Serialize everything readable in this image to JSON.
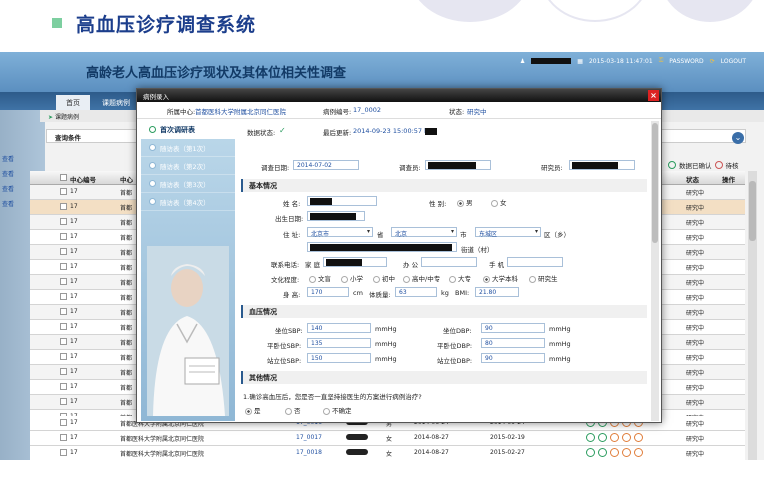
{
  "slide": {
    "title": "高血压诊疗调查系统"
  },
  "app": {
    "title": "高龄老人高血压诊疗现状及其体位相关性调查",
    "datetime": "2015-03-18 11:47:01",
    "password_label": "PASSWORD",
    "logout_label": "LOGOUT",
    "nav": {
      "home": "首页",
      "active_tab": "课题病例"
    },
    "breadcrumb": "课题病例",
    "query_label": "查询条件",
    "left_links": [
      "查看",
      "查看",
      "查看",
      "查看"
    ],
    "legend": {
      "confirm": "数据已确认",
      "pending": "待核"
    },
    "grid_head": {
      "center_id": "中心编号",
      "center": "中心",
      "status": "状态",
      "action": "操作"
    },
    "grid_rows": [
      {
        "center_id": "17",
        "center": "首都",
        "status": "研究中"
      },
      {
        "center_id": "17",
        "center": "首都",
        "status": "研究中",
        "selected": true
      },
      {
        "center_id": "17",
        "center": "首都",
        "status": "研究中"
      },
      {
        "center_id": "17",
        "center": "首都",
        "status": "研究中"
      },
      {
        "center_id": "17",
        "center": "首都",
        "status": "研究中"
      },
      {
        "center_id": "17",
        "center": "首都",
        "status": "研究中"
      },
      {
        "center_id": "17",
        "center": "首都",
        "status": "研究中"
      },
      {
        "center_id": "17",
        "center": "首都",
        "status": "研究中"
      },
      {
        "center_id": "17",
        "center": "首都",
        "status": "研究中"
      },
      {
        "center_id": "17",
        "center": "首都",
        "status": "研究中"
      },
      {
        "center_id": "17",
        "center": "首都",
        "status": "研究中"
      },
      {
        "center_id": "17",
        "center": "首都",
        "status": "研究中"
      },
      {
        "center_id": "17",
        "center": "首都",
        "status": "研究中"
      },
      {
        "center_id": "17",
        "center": "首都",
        "status": "研究中"
      },
      {
        "center_id": "17",
        "center": "首都",
        "status": "研究中"
      },
      {
        "center_id": "17",
        "center": "首都",
        "status": "研究中"
      },
      {
        "center_id": "17",
        "center": "首都",
        "status": "研究中"
      },
      {
        "center_id": "17",
        "center": "首都",
        "status": "研究中"
      }
    ],
    "bottom_rows": [
      {
        "center_id": "17",
        "center": "首都医科大学附属北京同仁医院",
        "case_id": "17_0016",
        "sex": "男",
        "date1": "2014-06-24",
        "date2": "2014-09-24",
        "status": "研究中"
      },
      {
        "center_id": "17",
        "center": "首都医科大学附属北京同仁医院",
        "case_id": "17_0017",
        "sex": "女",
        "date1": "2014-08-27",
        "date2": "2015-02-19",
        "status": "研究中"
      },
      {
        "center_id": "17",
        "center": "首都医科大学附属北京同仁医院",
        "case_id": "17_0018",
        "sex": "女",
        "date1": "2014-08-27",
        "date2": "2015-02-27",
        "status": "研究中"
      }
    ]
  },
  "modal": {
    "title": "病例录入",
    "close": "×",
    "center_label": "所属中心:",
    "center_value": "首都医科大学附属北京同仁医院",
    "case_label": "病例编号:",
    "case_value": "17_0002",
    "status_label": "状态:",
    "status_value": "研究中",
    "tabs": [
      "首次调研表",
      "随访表（第1次）",
      "随访表（第2次）",
      "随访表（第3次）",
      "随访表（第4次）"
    ],
    "data_status_label": "数据状态:",
    "last_update_label": "最后更新:",
    "last_update_value": "2014-09-23 15:00:57 by",
    "survey_date_label": "调查日期:",
    "survey_date_value": "2014-07-02",
    "surveyor_label": "调查员:",
    "researcher_label": "研究员:",
    "section_basic": "基本情况",
    "name_label": "姓 名:",
    "sex_label": "性 别:",
    "sex_male": "男",
    "sex_female": "女",
    "birth_label": "出生日期:",
    "address_label": "住 址:",
    "province": "北京市",
    "province_suffix": "省",
    "city": "北京",
    "city_suffix": "市",
    "district": "东城区",
    "district_suffix": "区（乡）",
    "street_label": "街道（村）",
    "phone_label": "联系电话:",
    "home_label": "家 庭",
    "office_label": "办 公",
    "mobile_label": "手 机",
    "edu_label": "文化程度:",
    "edu_options": [
      "文盲",
      "小学",
      "初中",
      "高中/中专",
      "大专",
      "大学本科",
      "研究生"
    ],
    "height_label": "身 高:",
    "height_value": "170",
    "height_unit": "cm",
    "weight_label": "体质量:",
    "weight_value": "63",
    "weight_unit": "kg",
    "bmi_label": "BMI:",
    "bmi_value": "21.80",
    "section_bp": "血压情况",
    "sit_sbp_label": "坐位SBP:",
    "sit_sbp_value": "140",
    "sit_dbp_label": "坐位DBP:",
    "sit_dbp_value": "90",
    "lie_sbp_label": "平卧位SBP:",
    "lie_sbp_value": "135",
    "lie_dbp_label": "平卧位DBP:",
    "lie_dbp_value": "80",
    "stand_sbp_label": "站立位SBP:",
    "stand_sbp_value": "150",
    "stand_dbp_label": "站立位DBP:",
    "stand_dbp_value": "90",
    "unit_mmhg": "mmHg",
    "section_other": "其他情况",
    "question1": "1.确诊高血压后，您是否一直坚持接医生的方案进行病例治疗?",
    "ans_yes": "是",
    "ans_no": "否",
    "ans_unsure": "不确定"
  }
}
